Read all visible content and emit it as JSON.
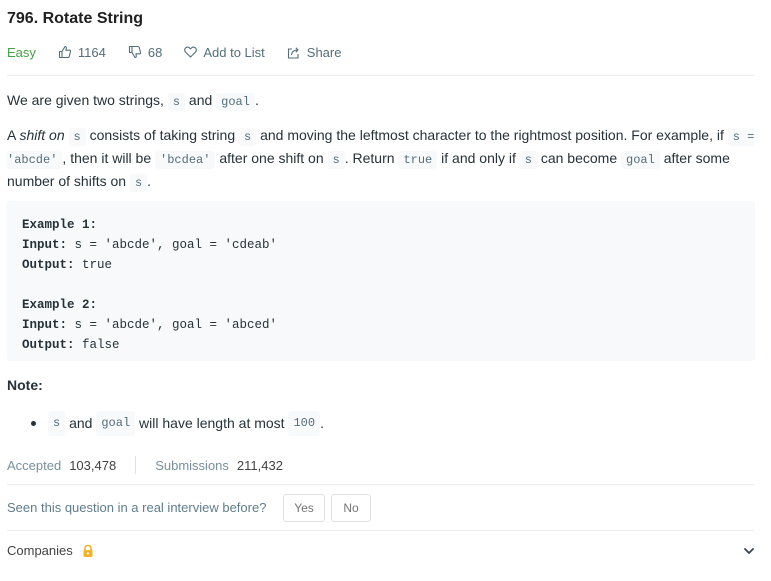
{
  "problem": {
    "title": "796. Rotate String",
    "difficulty": "Easy",
    "likes": "1164",
    "dislikes": "68",
    "add_to_list_label": "Add to List",
    "share_label": "Share"
  },
  "description": {
    "p1": {
      "t1": "We are given two strings, ",
      "c1": "s",
      "t2": " and ",
      "c2": "goal",
      "t3": "."
    },
    "p2": {
      "t1": "A ",
      "em": "shift on",
      "t2": " ",
      "c1": "s",
      "t3": " consists of taking string ",
      "c2": "s",
      "t4": " and moving the leftmost character to the rightmost position. For example, if ",
      "c3": "s = 'abcde'",
      "t5": ", then it will be ",
      "c4": "'bcdea'",
      "t6": " after one shift on ",
      "c5": "s",
      "t7": ". Return ",
      "c6": "true",
      "t8": " if and only if ",
      "c7": "s",
      "t9": " can become ",
      "c8": "goal",
      "t10": " after some number of shifts on ",
      "c9": "s",
      "t11": "."
    }
  },
  "examples": [
    {
      "heading": "Example 1:",
      "input_label": "Input:",
      "input": " s = 'abcde', goal = 'cdeab'",
      "output_label": "Output:",
      "output": " true"
    },
    {
      "heading": "Example 2:",
      "input_label": "Input:",
      "input": " s = 'abcde', goal = 'abced'",
      "output_label": "Output:",
      "output": " false"
    }
  ],
  "note": {
    "heading": "Note:",
    "c1": "s",
    "t1": " and ",
    "c2": "goal",
    "t2": " will have length at most ",
    "c3": "100",
    "t3": "."
  },
  "stats": {
    "accepted_label": "Accepted",
    "accepted": "103,478",
    "submissions_label": "Submissions",
    "submissions": "211,432"
  },
  "interview": {
    "question": "Seen this question in a real interview before?",
    "yes": "Yes",
    "no": "No"
  },
  "companies": {
    "label": "Companies"
  },
  "colors": {
    "easy": "#43a047",
    "lock": "#f0b429"
  }
}
